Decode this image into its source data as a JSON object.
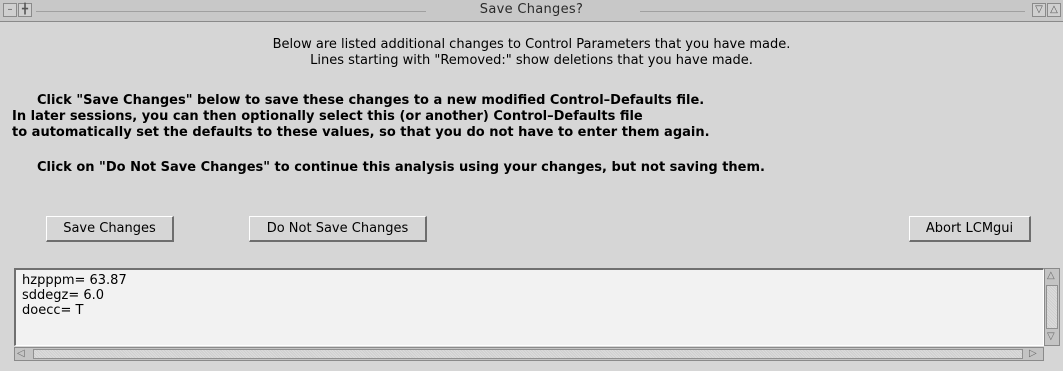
{
  "window": {
    "title": "Save Changes?"
  },
  "messages": {
    "intro_line1": "Below are listed additional changes to Control Parameters that you have made.",
    "intro_line2": "Lines starting with \"Removed:\" show deletions that you have made.",
    "save_line1": "Click \"Save Changes\" below to save these changes to a new modified Control–Defaults file.",
    "save_line2": "In later sessions, you can then optionally select this (or another) Control–Defaults file",
    "save_line3": "to automatically set the defaults to these values, so that you do not have to enter them again.",
    "nosave_line": "Click on \"Do Not Save Changes\" to continue this analysis using your changes, but not saving them."
  },
  "buttons": {
    "save": "Save Changes",
    "do_not_save": "Do Not Save Changes",
    "abort": "Abort LCMgui"
  },
  "changes": [
    "hzpppm= 63.87",
    "sddegz= 6.0",
    "doecc= T"
  ],
  "colors": {
    "window_bg": "#d6d6d6",
    "text_area_bg": "#f2f2f2"
  }
}
